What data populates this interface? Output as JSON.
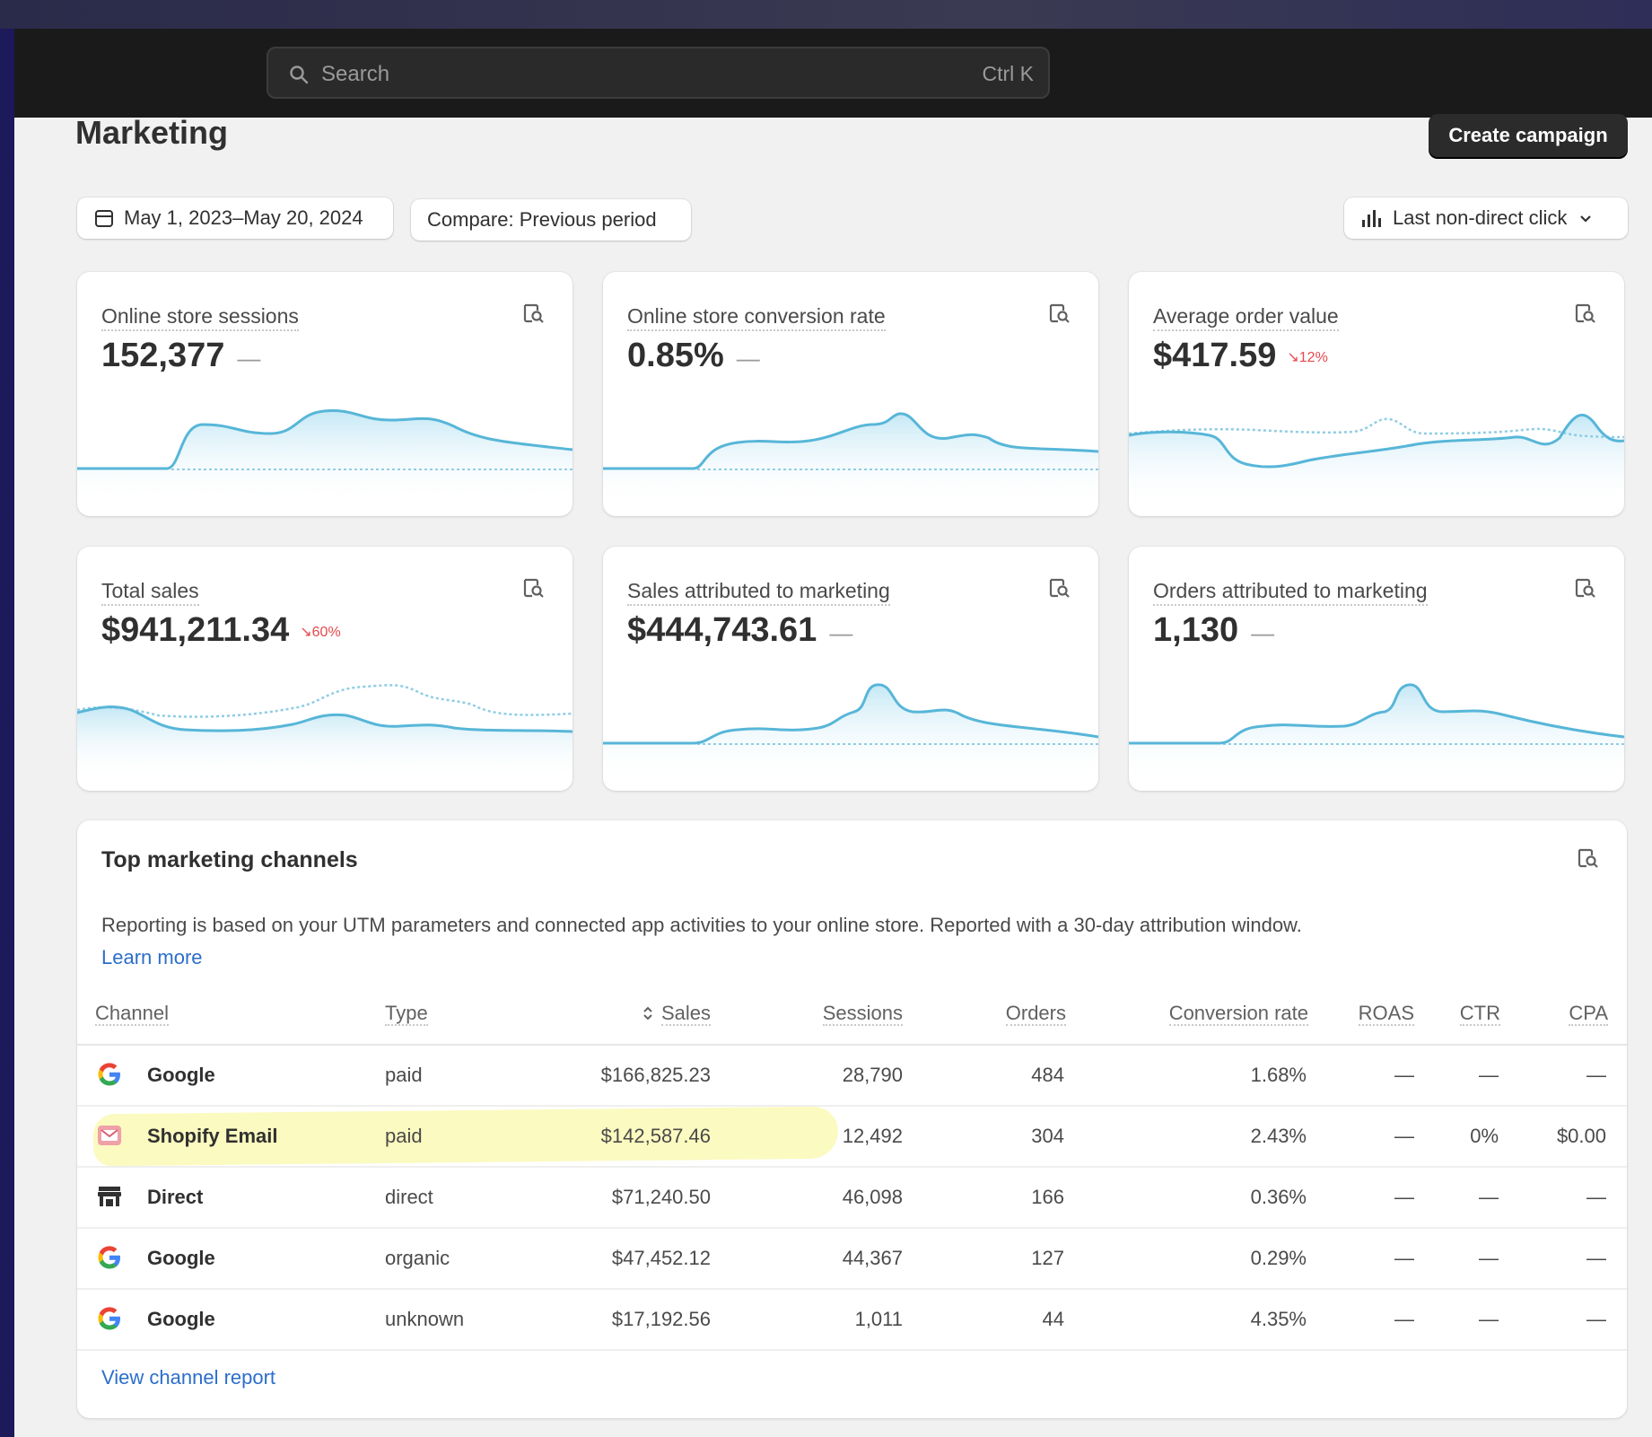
{
  "search": {
    "placeholder": "Search",
    "shortcut": "Ctrl K"
  },
  "page": {
    "title": "Marketing",
    "create_button": "Create campaign"
  },
  "filters": {
    "date_range": "May 1, 2023–May 20, 2024",
    "compare": "Compare: Previous period",
    "attribution": "Last non-direct click"
  },
  "metrics": [
    {
      "label": "Online store sessions",
      "value": "152,377",
      "change": "—",
      "change_color": "#9a9a9a"
    },
    {
      "label": "Online store conversion rate",
      "value": "0.85%",
      "change": "—",
      "change_color": "#9a9a9a"
    },
    {
      "label": "Average order value",
      "value": "$417.59",
      "change": "↘12%",
      "change_color": "#e5484d"
    },
    {
      "label": "Total sales",
      "value": "$941,211.34",
      "change": "↘60%",
      "change_color": "#e5484d"
    },
    {
      "label": "Sales attributed to marketing",
      "value": "$444,743.61",
      "change": "—",
      "change_color": "#9a9a9a"
    },
    {
      "label": "Orders attributed to marketing",
      "value": "1,130",
      "change": "—",
      "change_color": "#9a9a9a"
    }
  ],
  "channels": {
    "title": "Top marketing channels",
    "description": "Reporting is based on your UTM parameters and connected app activities to your online store. Reported with a 30-day attribution window.",
    "learn_more": "Learn more",
    "columns": [
      "Channel",
      "Type",
      "Sales",
      "Sessions",
      "Orders",
      "Conversion rate",
      "ROAS",
      "CTR",
      "CPA"
    ],
    "rows": [
      {
        "icon": "google-icon",
        "channel": "Google",
        "type": "paid",
        "sales": "$166,825.23",
        "sessions": "28,790",
        "orders": "484",
        "conversion": "1.68%",
        "roas": "—",
        "ctr": "—",
        "cpa": "—"
      },
      {
        "icon": "shopify-email-icon",
        "channel": "Shopify Email",
        "type": "paid",
        "sales": "$142,587.46",
        "sessions": "12,492",
        "orders": "304",
        "conversion": "2.43%",
        "roas": "—",
        "ctr": "0%",
        "cpa": "$0.00"
      },
      {
        "icon": "store-icon",
        "channel": "Direct",
        "type": "direct",
        "sales": "$71,240.50",
        "sessions": "46,098",
        "orders": "166",
        "conversion": "0.36%",
        "roas": "—",
        "ctr": "—",
        "cpa": "—"
      },
      {
        "icon": "google-icon",
        "channel": "Google",
        "type": "organic",
        "sales": "$47,452.12",
        "sessions": "44,367",
        "orders": "127",
        "conversion": "0.29%",
        "roas": "—",
        "ctr": "—",
        "cpa": "—"
      },
      {
        "icon": "google-icon",
        "channel": "Google",
        "type": "unknown",
        "sales": "$17,192.56",
        "sessions": "1,011",
        "orders": "44",
        "conversion": "4.35%",
        "roas": "—",
        "ctr": "—",
        "cpa": "—"
      }
    ],
    "view_report": "View channel report"
  },
  "colors": {
    "accent": "#2c6ecb",
    "spark_line": "#57b6d8",
    "decrease": "#e5484d",
    "highlight": "#fbfac0"
  }
}
